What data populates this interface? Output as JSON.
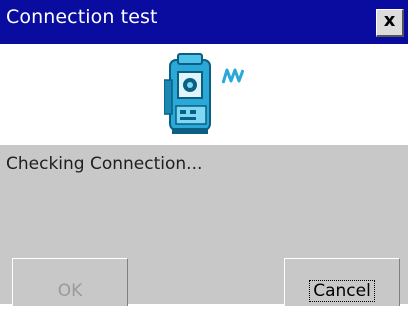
{
  "dialog": {
    "title": "Connection test",
    "close_label": "x",
    "message": "Checking Connection...",
    "buttons": {
      "ok": "OK",
      "cancel": "Cancel"
    }
  },
  "icons": {
    "device": "total-station-icon",
    "signal": "signal-waves-icon"
  },
  "colors": {
    "titlebar": "#0a0ca0",
    "body": "#c8c8c8",
    "icon_accent": "#2aa8d8",
    "disabled_text": "#9a9a9a"
  }
}
